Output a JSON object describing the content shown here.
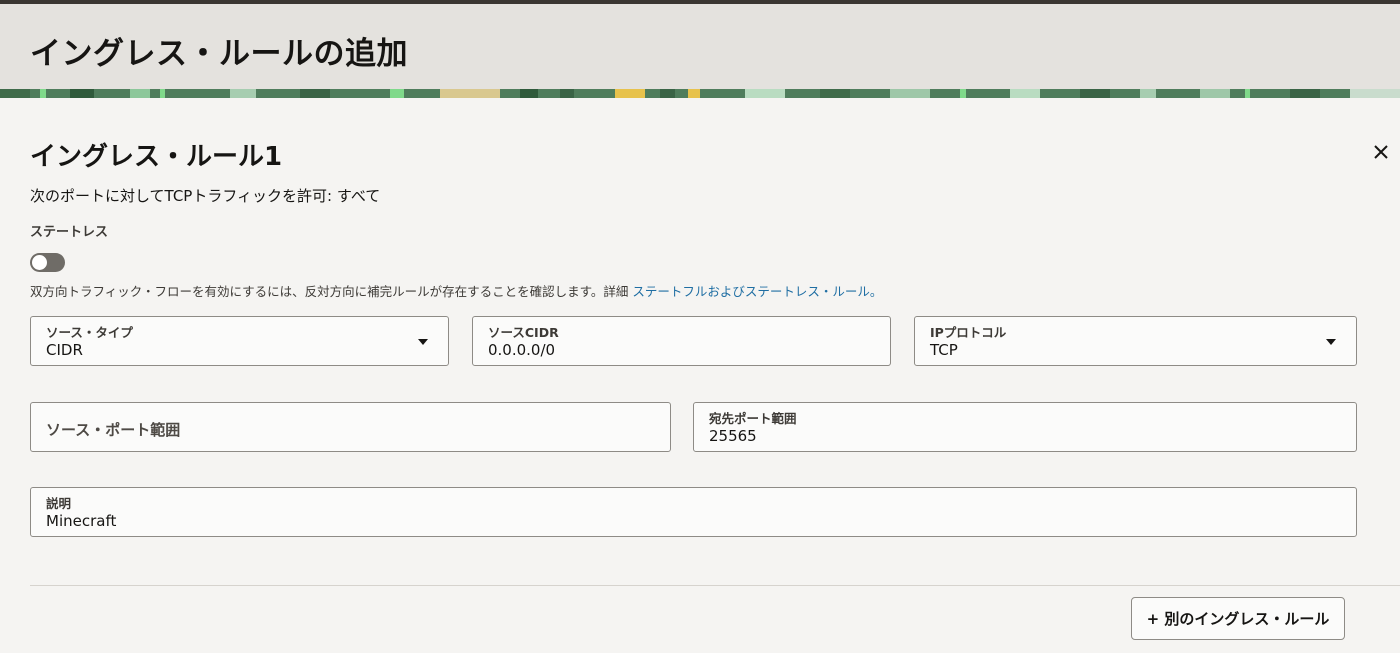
{
  "header": {
    "title": "イングレス・ルールの追加"
  },
  "rule": {
    "title": "イングレス・ルール1",
    "summary": "次のポートに対してTCPトラフィックを許可: すべて",
    "stateless_label": "ステートレス",
    "stateless_enabled": false,
    "help_text": "双方向トラフィック・フローを有効にするには、反対方向に補完ルールが存在することを確認します。詳細 ",
    "help_link": "ステートフルおよびステートレス・ルール。"
  },
  "fields": {
    "source_type": {
      "label": "ソース・タイプ",
      "value": "CIDR"
    },
    "source_cidr": {
      "label": "ソースCIDR",
      "value": "0.0.0.0/0"
    },
    "ip_protocol": {
      "label": "IPプロトコル",
      "value": "TCP"
    },
    "source_port": {
      "placeholder": "ソース・ポート範囲"
    },
    "dest_port": {
      "label": "宛先ポート範囲",
      "value": "25565"
    },
    "description": {
      "label": "説明",
      "value": "Minecraft"
    }
  },
  "actions": {
    "add_rule_label": "+ 別のイングレス・ルール"
  },
  "icons": {
    "close": "close-icon",
    "dropdown": "chevron-down-icon"
  },
  "colors": {
    "accent_link": "#1f6ea3",
    "banner": "#4f7d5c",
    "header_bg": "#e4e2de"
  }
}
